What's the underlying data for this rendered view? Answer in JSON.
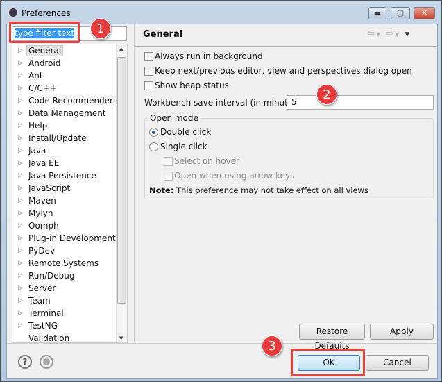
{
  "window": {
    "title": "Preferences",
    "minimize": "▬",
    "maximize": "▢",
    "close": "✕"
  },
  "filter": {
    "value": "type filter text"
  },
  "annotations": {
    "one": "1",
    "two": "2",
    "three": "3"
  },
  "tree": {
    "items": [
      "General",
      "Android",
      "Ant",
      "C/C++",
      "Code Recommenders",
      "Data Management",
      "Help",
      "Install/Update",
      "Java",
      "Java EE",
      "Java Persistence",
      "JavaScript",
      "Maven",
      "Mylyn",
      "Oomph",
      "Plug-in Development",
      "PyDev",
      "Remote Systems",
      "Run/Debug",
      "Server",
      "Team",
      "Terminal",
      "TestNG",
      "Validation"
    ],
    "selected": "General"
  },
  "page": {
    "title": "General",
    "options": [
      "Always run in background",
      "Keep next/previous editor, view and perspectives dialog open",
      "Show heap status"
    ],
    "interval_label": "Workbench save interval (in minutes):",
    "interval_value": "5",
    "group_title": "Open mode",
    "radio_double": "Double click",
    "radio_single": "Single click",
    "select_on_hover": "Select on hover",
    "open_arrow": "Open when using arrow keys",
    "note_bold": "Note:",
    "note_text": " This preference may not take effect on all views",
    "restore": "Restore Defaults",
    "apply": "Apply"
  },
  "footer": {
    "ok": "OK",
    "cancel": "Cancel",
    "help": "?"
  }
}
